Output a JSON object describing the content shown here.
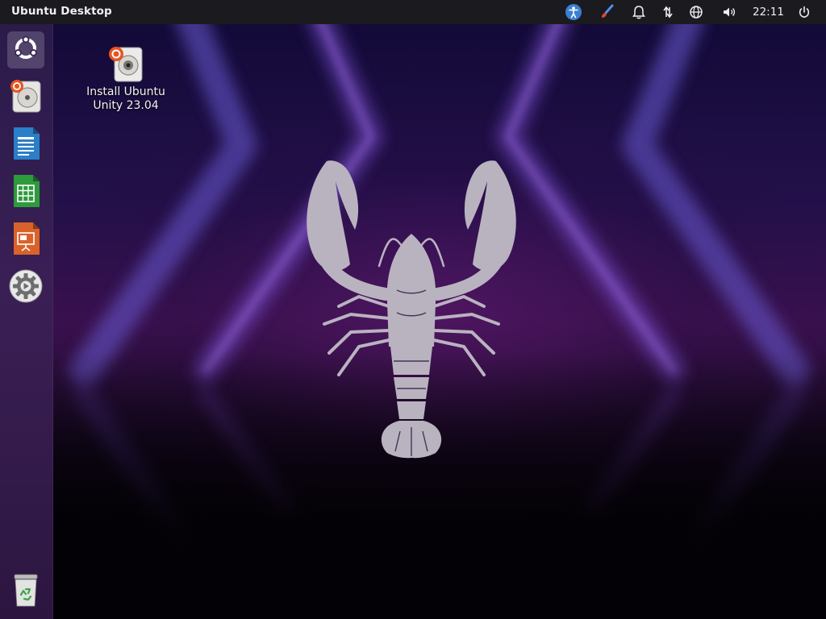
{
  "top_panel": {
    "title": "Ubuntu Desktop",
    "clock": "22:11",
    "indicators": [
      "accessibility-icon",
      "paintbrush-icon",
      "bell-icon",
      "network-transfer-icon",
      "globe-icon",
      "volume-icon",
      "power-icon"
    ]
  },
  "launcher": {
    "items": [
      {
        "name": "ubuntu-dash",
        "icon": "ubuntu-logo-icon",
        "active": true
      },
      {
        "name": "install-ubuntu",
        "icon": "installer-disk-icon"
      },
      {
        "name": "libreoffice-writer",
        "icon": "writer-document-icon"
      },
      {
        "name": "libreoffice-calc",
        "icon": "calc-spreadsheet-icon"
      },
      {
        "name": "libreoffice-impress",
        "icon": "impress-presentation-icon"
      },
      {
        "name": "system-settings",
        "icon": "gear-icon"
      }
    ],
    "trash": {
      "icon": "trash-icon"
    }
  },
  "desktop": {
    "icons": [
      {
        "label_line1": "Install Ubuntu",
        "label_line2": "Unity 23.04",
        "icon": "installer-disk-icon"
      }
    ]
  },
  "colors": {
    "panel_bg": "#1b1a1f",
    "launcher_bg": "#2a1b4a",
    "accent_orange": "#e95420",
    "lobster": "#b9b3c0"
  }
}
